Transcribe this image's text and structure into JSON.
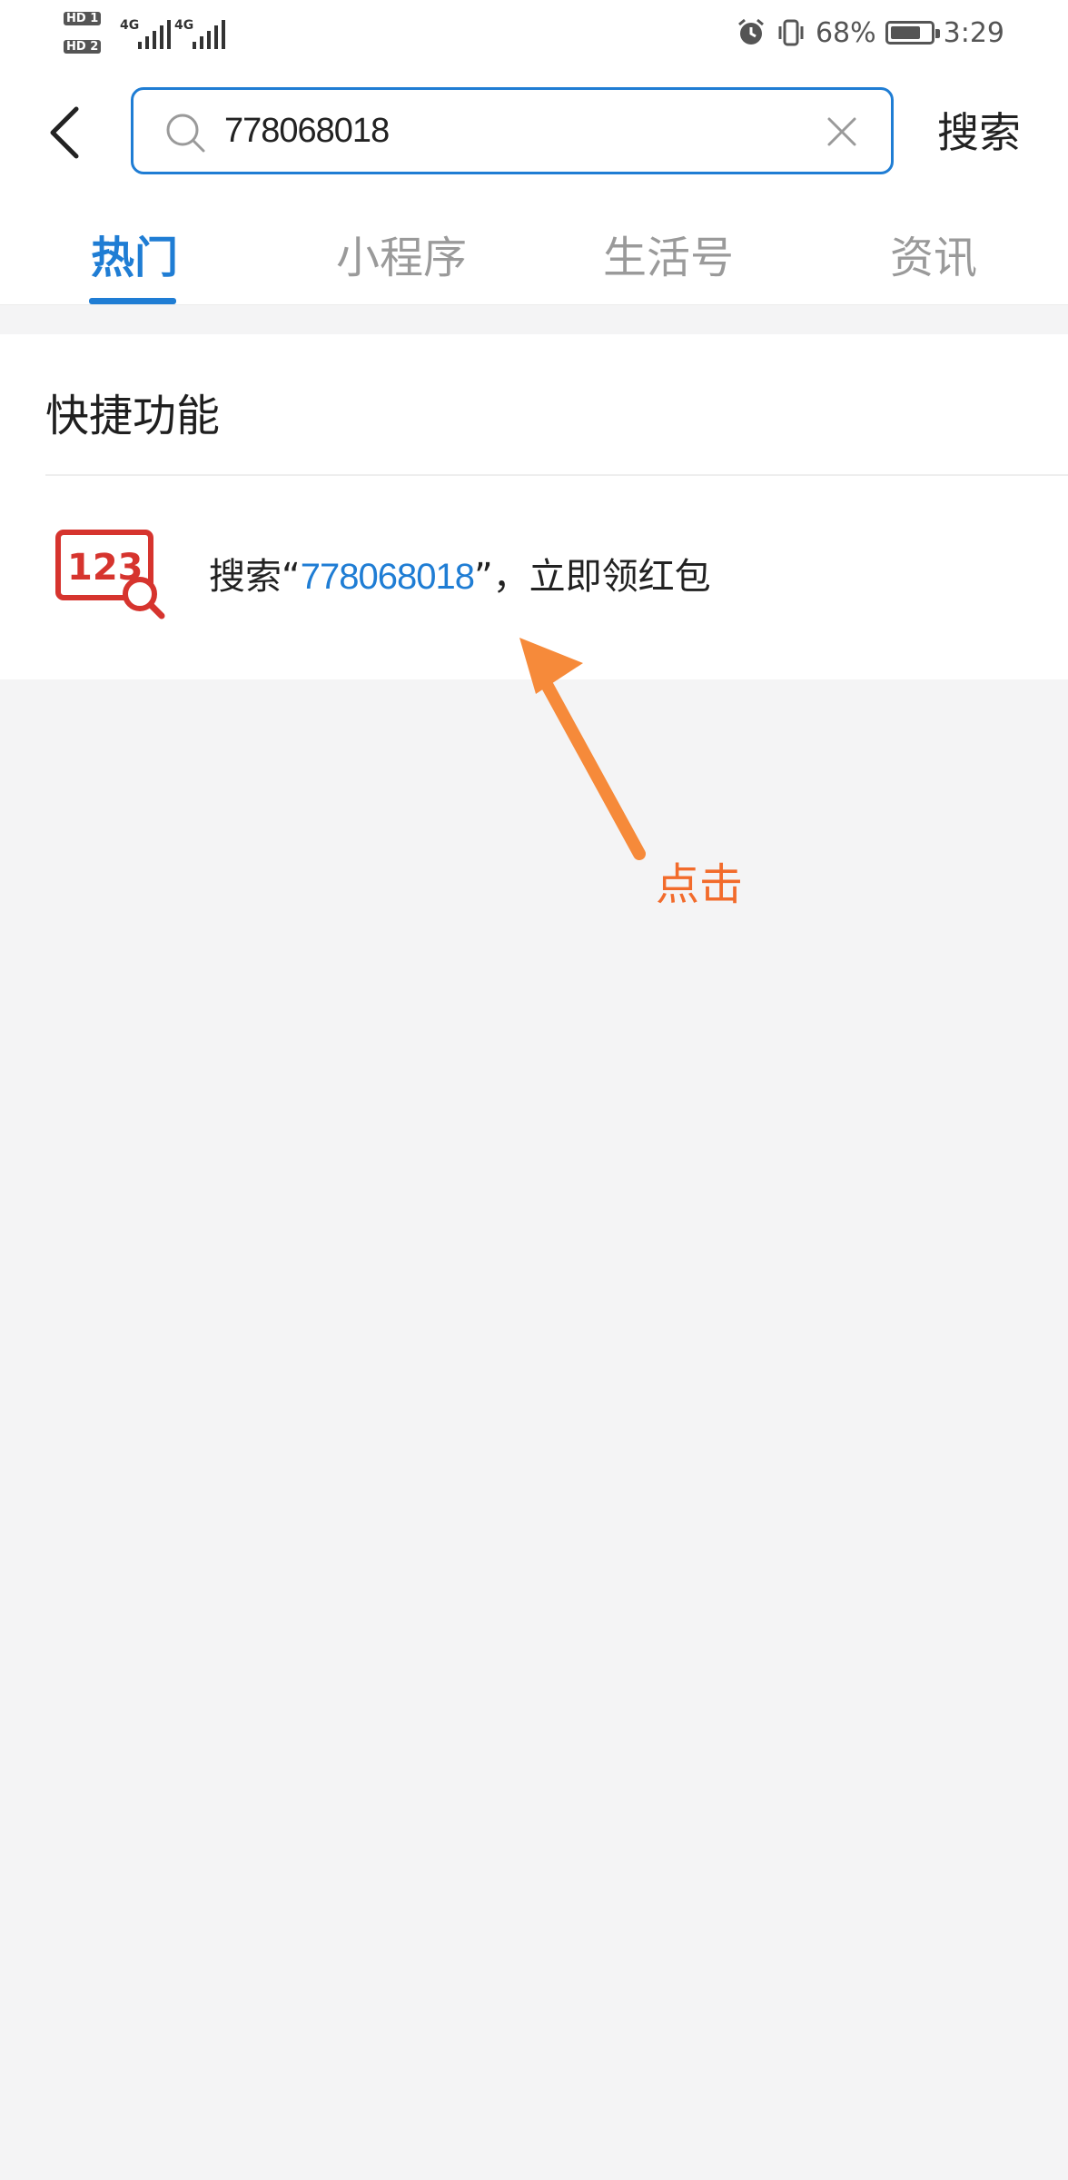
{
  "status_bar": {
    "sim1": "HD 1",
    "sim2": "HD 2",
    "net1": "4G",
    "net2": "4G",
    "battery_percent": "68%",
    "battery_level": 0.68,
    "time": "3:29"
  },
  "search": {
    "value": "778068018",
    "button_label": "搜索"
  },
  "tabs": [
    {
      "label": "热门",
      "active": true
    },
    {
      "label": "小程序",
      "active": false
    },
    {
      "label": "生活号",
      "active": false
    },
    {
      "label": "资讯",
      "active": false
    }
  ],
  "quick_functions": {
    "title": "快捷功能",
    "item": {
      "icon_text": "123",
      "prefix": "搜索“",
      "number": "778068018",
      "suffix": "”，立即领红包"
    }
  },
  "annotation": {
    "label": "点击",
    "color": "#f26b2b"
  },
  "colors": {
    "accent": "#1f7dd4",
    "icon_red": "#d6342e",
    "arrow_orange": "#f68a3a"
  }
}
